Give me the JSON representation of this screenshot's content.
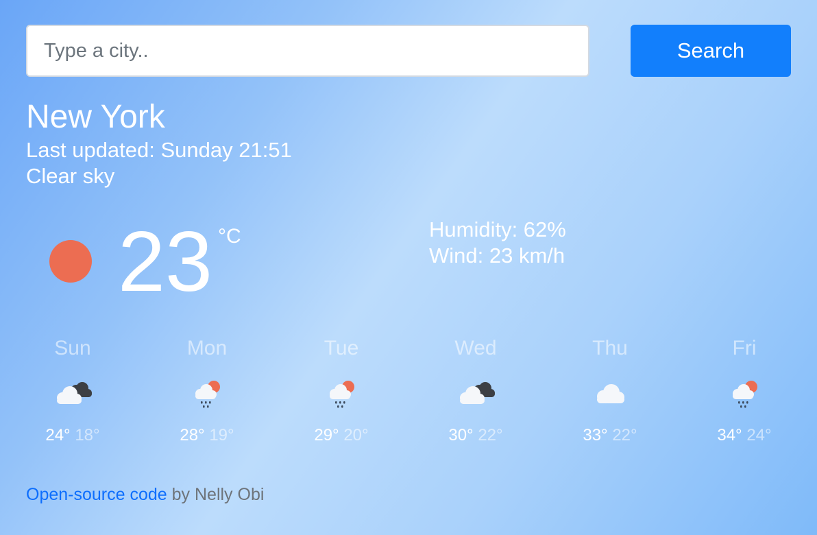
{
  "search": {
    "placeholder": "Type a city..",
    "value": "",
    "button_label": "Search"
  },
  "current": {
    "city": "New York",
    "updated": "Last updated: Sunday 21:51",
    "description": "Clear sky",
    "icon": "sun-icon",
    "temperature": "23",
    "unit": "°C",
    "humidity": "Humidity: 62%",
    "wind": "Wind: 23 km/h"
  },
  "forecast": [
    {
      "day": "Sun",
      "icon": "overcast-clouds-icon",
      "max": "24°",
      "min": "18°"
    },
    {
      "day": "Mon",
      "icon": "rain-sun-icon",
      "max": "28°",
      "min": "19°"
    },
    {
      "day": "Tue",
      "icon": "rain-sun-icon",
      "max": "29°",
      "min": "20°"
    },
    {
      "day": "Wed",
      "icon": "overcast-clouds-icon",
      "max": "30°",
      "min": "22°"
    },
    {
      "day": "Thu",
      "icon": "cloud-icon",
      "max": "33°",
      "min": "22°"
    },
    {
      "day": "Fri",
      "icon": "rain-sun-icon",
      "max": "34°",
      "min": "24°"
    }
  ],
  "footer": {
    "link_text": "Open-source code",
    "byline": " by Nelly Obi"
  },
  "colors": {
    "accent": "#127ffc",
    "sun": "#ec6d52",
    "link": "#0d6efd"
  }
}
